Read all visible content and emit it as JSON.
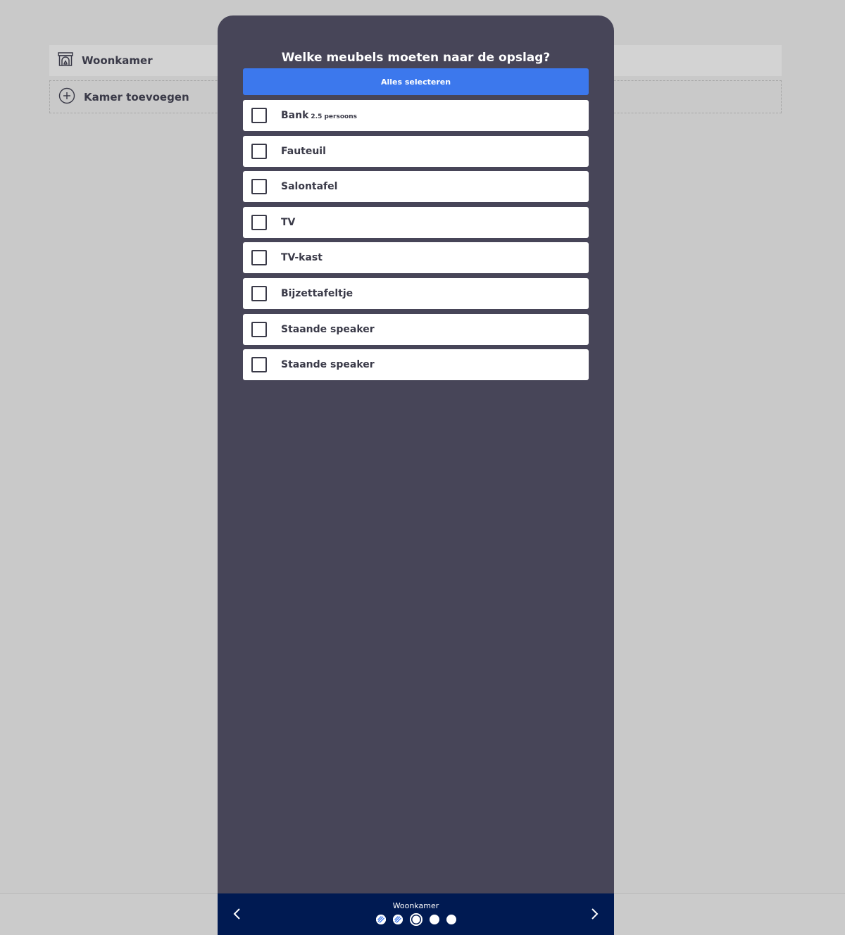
{
  "background": {
    "rooms": [
      {
        "label": "Woonkamer",
        "icon": "fireplace-icon"
      }
    ],
    "add_room_label": "Kamer toevoegen"
  },
  "modal": {
    "title": "Welke meubels moeten naar de opslag?",
    "select_all_label": "Alles selecteren",
    "items": [
      {
        "label": "Bank",
        "sub": "2.5 persoons",
        "checked": false
      },
      {
        "label": "Fauteuil",
        "sub": "",
        "checked": false
      },
      {
        "label": "Salontafel",
        "sub": "",
        "checked": false
      },
      {
        "label": "TV",
        "sub": "",
        "checked": false
      },
      {
        "label": "TV-kast",
        "sub": "",
        "checked": false
      },
      {
        "label": "Bijzettafeltje",
        "sub": "",
        "checked": false
      },
      {
        "label": "Staande speaker",
        "sub": "",
        "checked": false
      },
      {
        "label": "Staande speaker",
        "sub": "",
        "checked": false
      }
    ]
  },
  "footer": {
    "step_title": "Woonkamer",
    "steps": [
      "done",
      "done",
      "current",
      "todo",
      "todo"
    ],
    "prev_icon": "chevron-left-icon",
    "next_icon": "chevron-right-icon"
  },
  "colors": {
    "modal_bg": "#474558",
    "accent": "#3c78ed",
    "footer_bg": "#001a52",
    "page_bg": "#c9c9c9"
  }
}
